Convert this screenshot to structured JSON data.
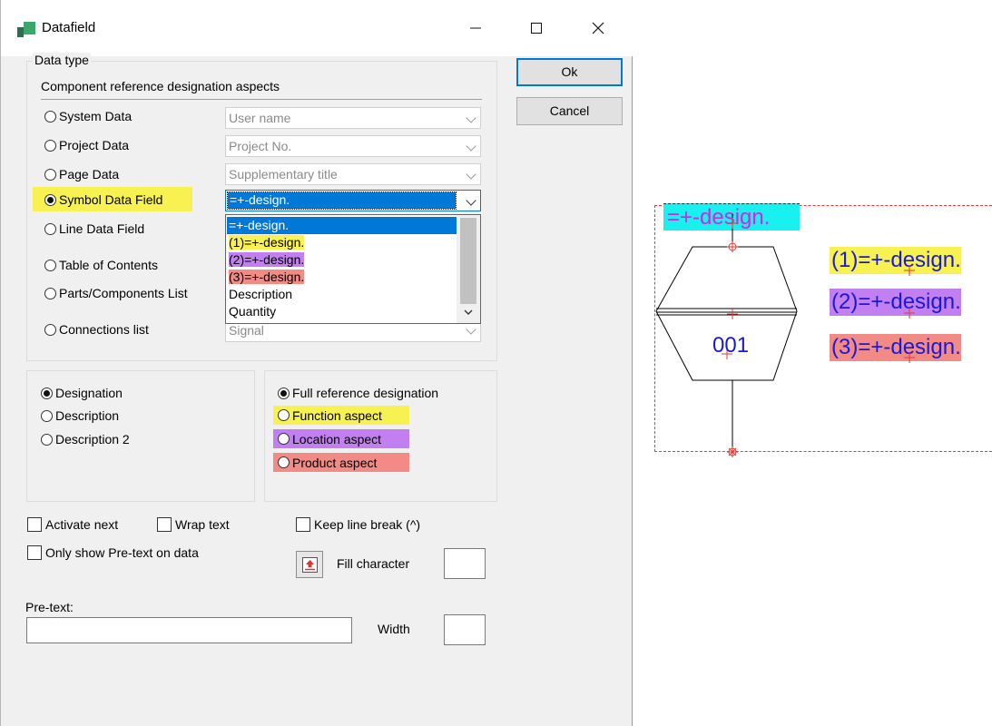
{
  "window": {
    "title": "Datafield"
  },
  "colors": {
    "yellow": "#f7f151",
    "purple": "#c17fef",
    "red": "#f28b86",
    "cyan": "#19f0f0",
    "selection": "#0078d7"
  },
  "data_type": {
    "group_title": "Data type",
    "subtitle": "Component reference designation aspects",
    "options": [
      {
        "label": "System Data",
        "combo": "User name",
        "checked": false
      },
      {
        "label": "Project Data",
        "combo": "Project No.",
        "checked": false
      },
      {
        "label": "Page Data",
        "combo": "Supplementary title",
        "checked": false
      },
      {
        "label": "Symbol Data Field",
        "combo": "=+-design.",
        "checked": true
      },
      {
        "label": "Line Data Field",
        "checked": false
      },
      {
        "label": "Table of Contents",
        "checked": false
      },
      {
        "label": "Parts/Components List",
        "checked": false
      },
      {
        "label": "Connections list",
        "combo": "Signal",
        "checked": false
      }
    ],
    "dropdown_items": [
      "=+-design.",
      "(1)=+-design.",
      "(2)=+-design.",
      "(3)=+-design.",
      "Description",
      "Quantity"
    ]
  },
  "designation_group": {
    "options": [
      "Designation",
      "Description",
      "Description 2"
    ],
    "selected": "Designation"
  },
  "aspect_group": {
    "options": [
      "Full reference designation",
      "Function aspect",
      "Location aspect",
      "Product aspect"
    ],
    "selected": "Full reference designation"
  },
  "checkboxes": {
    "activate_next": "Activate next",
    "wrap_text": "Wrap text",
    "keep_line_break": "Keep line break (^)",
    "only_pretext": "Only show Pre-text on data"
  },
  "fill_character": {
    "label": "Fill character",
    "value": ""
  },
  "pretext": {
    "label": "Pre-text:",
    "value": ""
  },
  "width": {
    "label": "Width",
    "value": ""
  },
  "buttons": {
    "ok": "Ok",
    "cancel": "Cancel"
  },
  "canvas": {
    "header": "=+-design.",
    "labels": [
      "(1)=+-design.",
      "(2)=+-design.",
      "(3)=+-design."
    ],
    "symbol_number": "001"
  }
}
